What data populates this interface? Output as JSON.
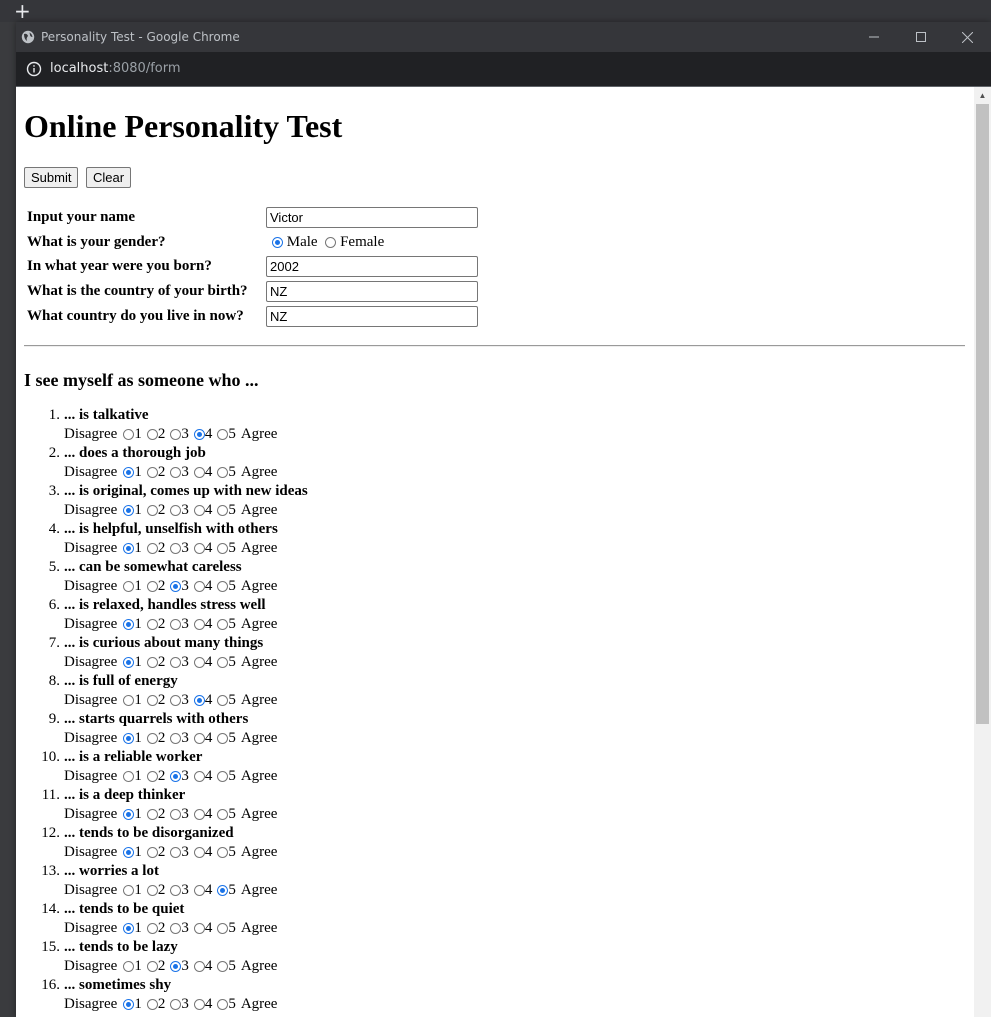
{
  "browser": {
    "title": "Personality Test - Google Chrome",
    "url_host": "localhost",
    "url_rest": ":8080/form"
  },
  "page": {
    "heading": "Online Personality Test",
    "submit_label": "Submit",
    "clear_label": "Clear"
  },
  "profile": {
    "name_label": "Input your name",
    "name_value": "Victor",
    "gender_label": "What is your gender?",
    "gender_male": "Male",
    "gender_female": "Female",
    "gender_selected": "Male",
    "year_label": "In what year were you born?",
    "year_value": "2002",
    "birth_country_label": "What is the country of your birth?",
    "birth_country_value": "NZ",
    "live_country_label": "What country do you live in now?",
    "live_country_value": "NZ"
  },
  "survey": {
    "heading": "I see myself as someone who ...",
    "disagree_label": "Disagree",
    "agree_label": "Agree",
    "scale": [
      "1",
      "2",
      "3",
      "4",
      "5"
    ],
    "questions": [
      {
        "num": "1.",
        "text": "... is talkative",
        "selected": 4
      },
      {
        "num": "2.",
        "text": "... does a thorough job",
        "selected": 1
      },
      {
        "num": "3.",
        "text": "... is original, comes up with new ideas",
        "selected": 1
      },
      {
        "num": "4.",
        "text": "... is helpful, unselfish with others",
        "selected": 1
      },
      {
        "num": "5.",
        "text": "... can be somewhat careless",
        "selected": 3
      },
      {
        "num": "6.",
        "text": "... is relaxed, handles stress well",
        "selected": 1
      },
      {
        "num": "7.",
        "text": "... is curious about many things",
        "selected": 1
      },
      {
        "num": "8.",
        "text": "... is full of energy",
        "selected": 4
      },
      {
        "num": "9.",
        "text": "... starts quarrels with others",
        "selected": 1
      },
      {
        "num": "10.",
        "text": "... is a reliable worker",
        "selected": 3
      },
      {
        "num": "11.",
        "text": "... is a deep thinker",
        "selected": 1
      },
      {
        "num": "12.",
        "text": "... tends to be disorganized",
        "selected": 1
      },
      {
        "num": "13.",
        "text": "... worries a lot",
        "selected": 5
      },
      {
        "num": "14.",
        "text": "... tends to be quiet",
        "selected": 1
      },
      {
        "num": "15.",
        "text": "... tends to be lazy",
        "selected": 3
      },
      {
        "num": "16.",
        "text": "... sometimes shy",
        "selected": 1
      }
    ]
  },
  "colors": {
    "accent": "#1a73e8",
    "chrome_dark": "#35363a",
    "addressbar": "#202124"
  }
}
